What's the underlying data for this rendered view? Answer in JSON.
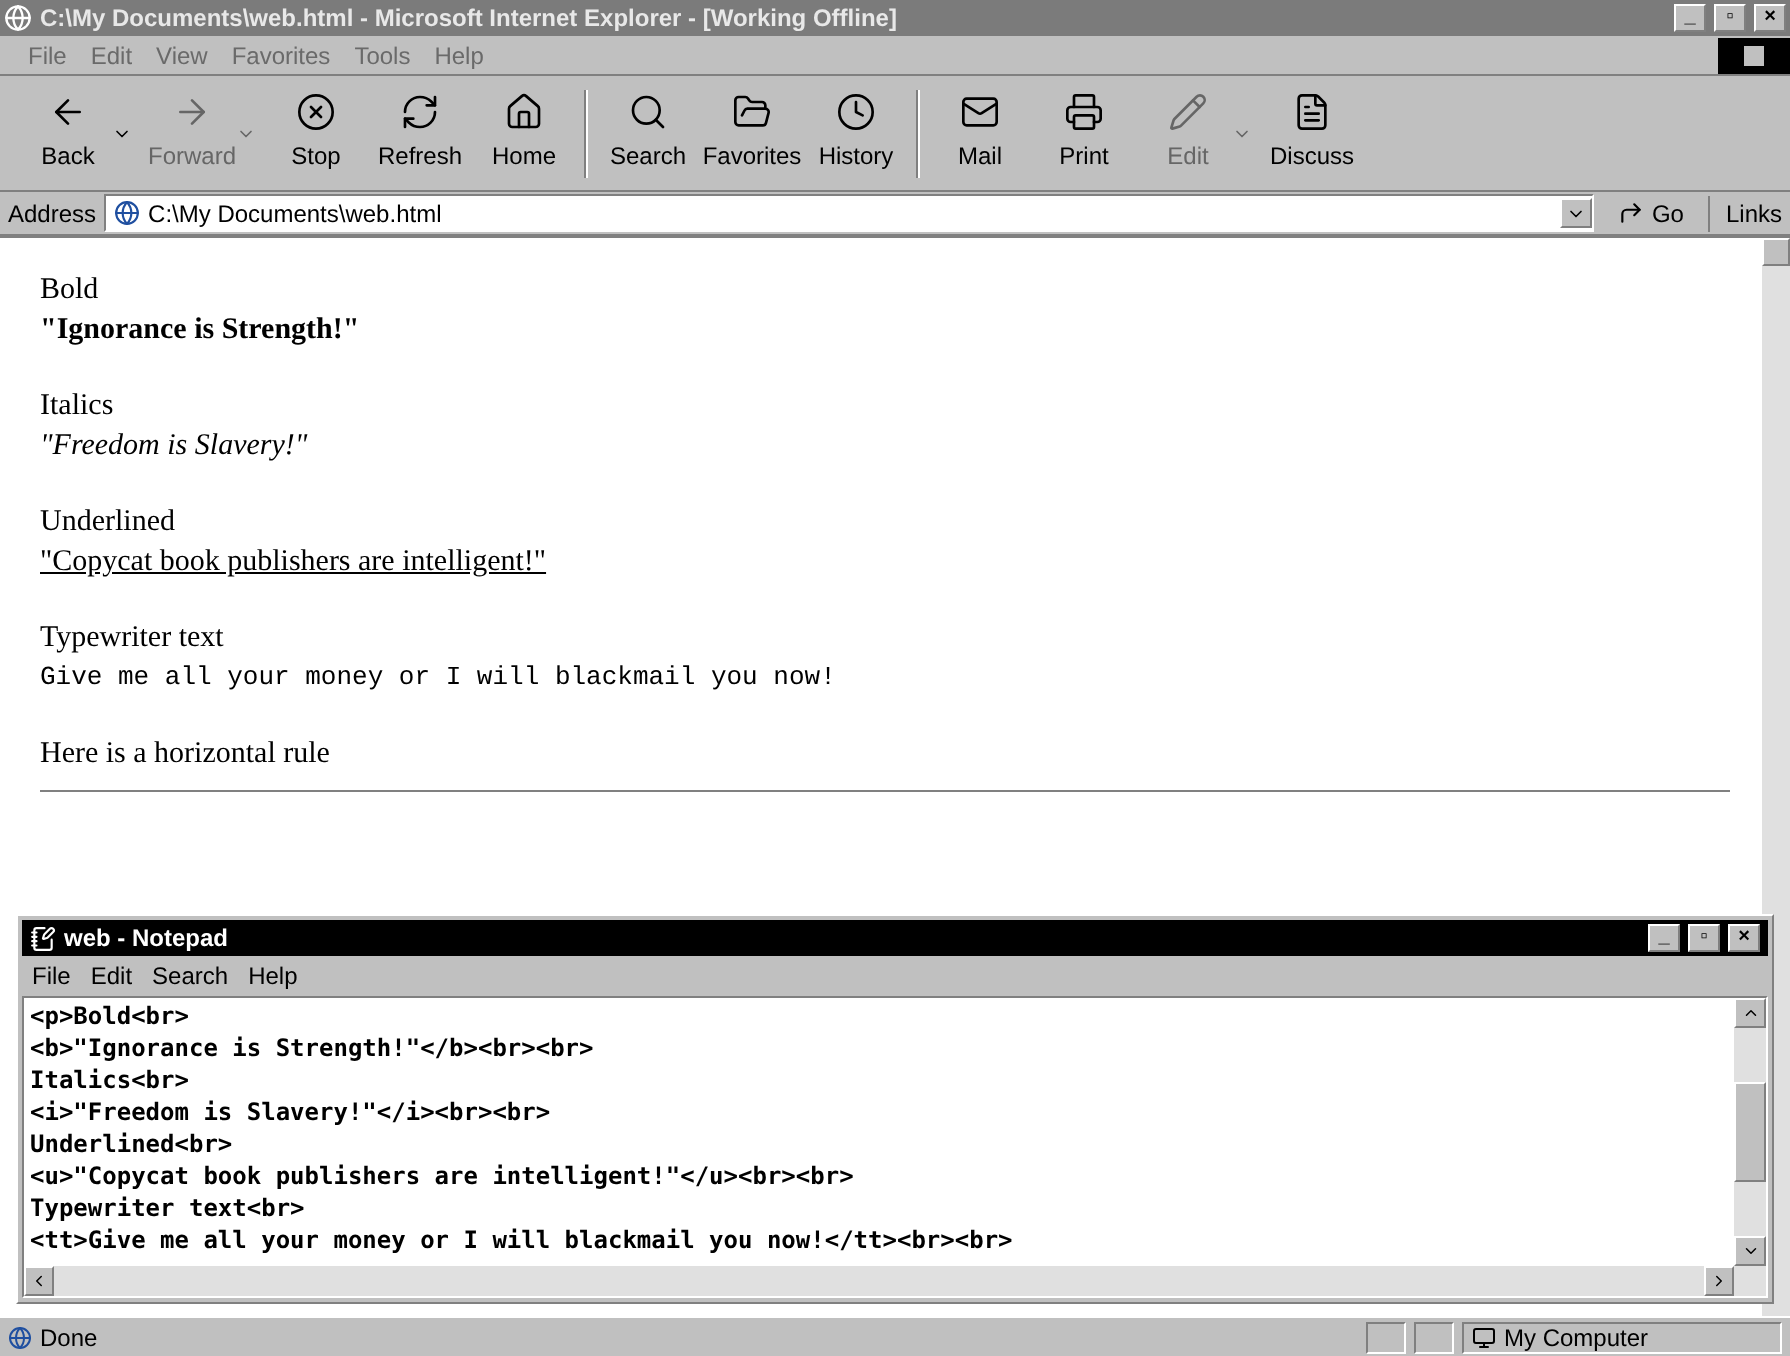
{
  "window": {
    "title": "C:\\My Documents\\web.html - Microsoft Internet Explorer - [Working Offline]",
    "controls": [
      "_",
      "▫",
      "×"
    ]
  },
  "menu": [
    {
      "label": "File",
      "disabled": true
    },
    {
      "label": "Edit",
      "disabled": true
    },
    {
      "label": "View",
      "disabled": true
    },
    {
      "label": "Favorites",
      "disabled": true
    },
    {
      "label": "Tools",
      "disabled": true
    },
    {
      "label": "Help",
      "disabled": true
    }
  ],
  "toolbar": [
    {
      "label": "Back",
      "disabled": false,
      "dropdown": true
    },
    {
      "label": "Forward",
      "disabled": true,
      "dropdown": true
    },
    {
      "label": "Stop",
      "disabled": false,
      "dropdown": false
    },
    {
      "label": "Refresh",
      "disabled": false,
      "dropdown": false
    },
    {
      "label": "Home",
      "disabled": false,
      "dropdown": false
    },
    {
      "label": "Search",
      "disabled": false,
      "dropdown": false
    },
    {
      "label": "Favorites",
      "disabled": false,
      "dropdown": false
    },
    {
      "label": "History",
      "disabled": false,
      "dropdown": false
    },
    {
      "label": "Mail",
      "disabled": false,
      "dropdown": false
    },
    {
      "label": "Print",
      "disabled": false,
      "dropdown": false
    },
    {
      "label": "Edit",
      "disabled": true,
      "dropdown": true
    },
    {
      "label": "Discuss",
      "disabled": false,
      "dropdown": false
    }
  ],
  "address": {
    "label": "Address",
    "value": "C:\\My Documents\\web.html",
    "go": "Go",
    "links": "Links"
  },
  "page": [
    {
      "kind": "plain",
      "text": "Bold"
    },
    {
      "kind": "bold",
      "text": "\"Ignorance is Strength!\""
    },
    {
      "kind": "gap"
    },
    {
      "kind": "plain",
      "text": "Italics"
    },
    {
      "kind": "italic",
      "text": "\"Freedom is Slavery!\""
    },
    {
      "kind": "gap"
    },
    {
      "kind": "plain",
      "text": "Underlined"
    },
    {
      "kind": "underline",
      "text": "\"Copycat book publishers are intelligent!\""
    },
    {
      "kind": "gap"
    },
    {
      "kind": "plain",
      "text": "Typewriter text"
    },
    {
      "kind": "mono",
      "text": "Give me all your money or I will blackmail you now!"
    },
    {
      "kind": "gap"
    },
    {
      "kind": "plain",
      "text": "Here is a horizontal rule"
    },
    {
      "kind": "rule"
    }
  ],
  "notepad": {
    "title": "web - Notepad",
    "menu": [
      "File",
      "Edit",
      "Search",
      "Help"
    ],
    "lines": [
      "<p>Bold<br>",
      "<b>\"Ignorance is Strength!\"</b><br><br>",
      "Italics<br>",
      "<i>\"Freedom is Slavery!\"</i><br><br>",
      "Underlined<br>",
      "<u>\"Copycat book publishers are intelligent!\"</u><br><br>",
      "Typewriter text<br>",
      "<tt>Give me all your money or I will blackmail you now!</tt><br><br>"
    ]
  },
  "status_bar": {
    "text": "Done",
    "zone": "My Computer"
  }
}
